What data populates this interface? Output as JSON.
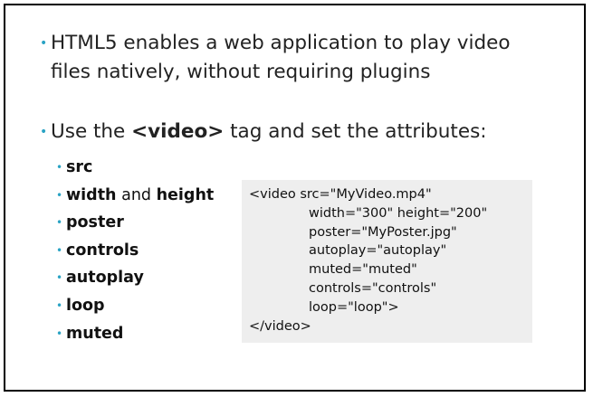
{
  "bullets": [
    {
      "text": "HTML5 enables a web application to play video files natively, without requiring plugins"
    },
    {
      "prefix": "Use the ",
      "tag": "<video>",
      "suffix": " tag and set the attributes:"
    }
  ],
  "attributes": [
    {
      "bold": "src"
    },
    {
      "bold": "width",
      "middle": " and ",
      "bold2": "height"
    },
    {
      "bold": "poster"
    },
    {
      "bold": "controls"
    },
    {
      "bold": "autoplay"
    },
    {
      "bold": "loop"
    },
    {
      "bold": "muted"
    }
  ],
  "code": {
    "lines": [
      "<video src=\"MyVideo.mp4\"",
      "width=\"300\" height=\"200\"",
      "poster=\"MyPoster.jpg\"",
      "autoplay=\"autoplay\"",
      "muted=\"muted\"",
      "controls=\"controls\"",
      "loop=\"loop\">",
      "</video>"
    ]
  },
  "colors": {
    "bullet_accent": "#2aa3c4",
    "code_background": "#eeeeee",
    "slide_border": "#000000"
  }
}
